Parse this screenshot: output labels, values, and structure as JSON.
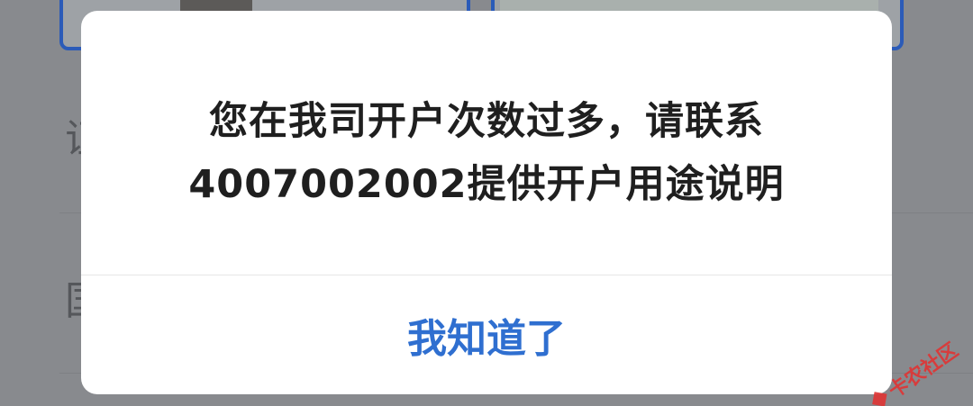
{
  "dialog": {
    "message_line1": "您在我司开户次数过多，请联系",
    "message_line2": "4007002002提供开户用途说明",
    "confirm_label": "我知道了"
  },
  "background": {
    "label1": "证",
    "label2": "国"
  },
  "watermark": {
    "text": "卡农社区"
  },
  "colors": {
    "accent": "#2f6fd0",
    "overlay": "#888a8e",
    "dialog_bg": "#ffffff",
    "text": "#1f1f1f",
    "watermark": "#e03434"
  }
}
